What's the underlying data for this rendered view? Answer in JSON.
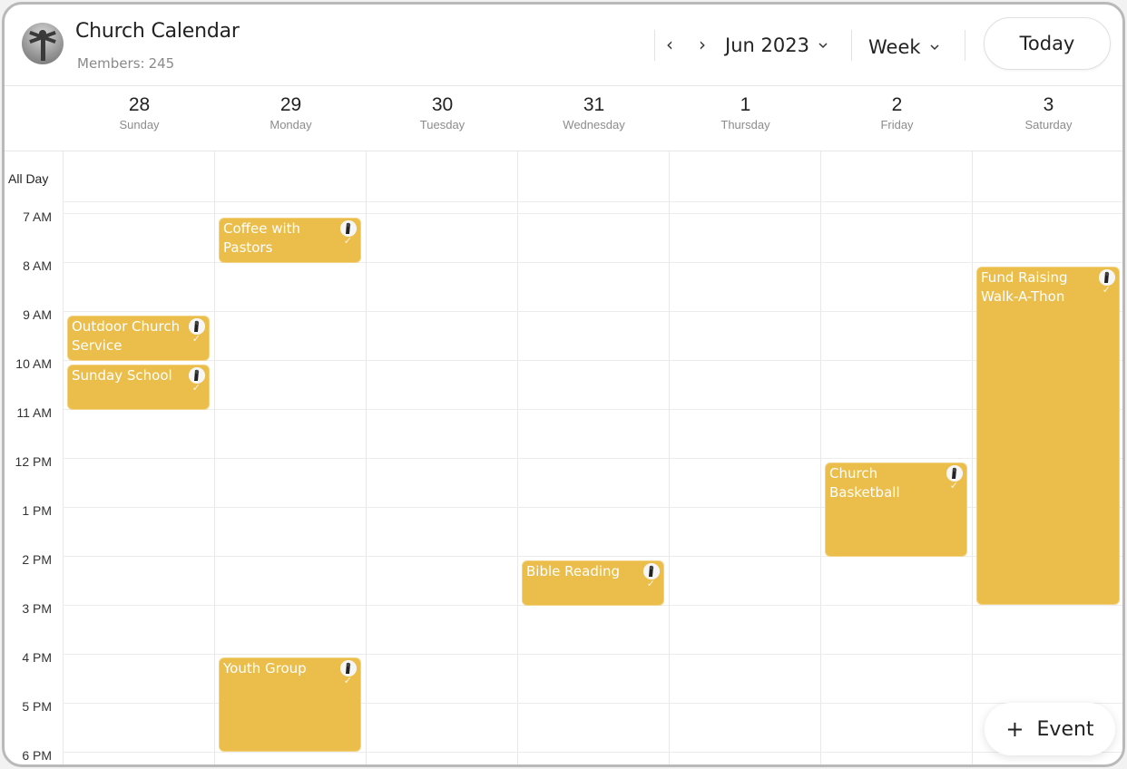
{
  "header": {
    "title": "Church Calendar",
    "members_label": "Members:",
    "members_count": "245",
    "month_label": "Jun 2023",
    "view_label": "Week",
    "today_label": "Today",
    "prev_icon": "chevron-left-icon",
    "next_icon": "chevron-right-icon"
  },
  "days": [
    {
      "num": "28",
      "name": "Sunday"
    },
    {
      "num": "29",
      "name": "Monday"
    },
    {
      "num": "30",
      "name": "Tuesday"
    },
    {
      "num": "31",
      "name": "Wednesday"
    },
    {
      "num": "1",
      "name": "Thursday"
    },
    {
      "num": "2",
      "name": "Friday"
    },
    {
      "num": "3",
      "name": "Saturday"
    }
  ],
  "all_day_label": "All Day",
  "hours": [
    "7 AM",
    "8 AM",
    "9 AM",
    "10 AM",
    "11 AM",
    "12 PM",
    "1 PM",
    "2 PM",
    "3 PM",
    "4 PM",
    "5 PM",
    "6 PM"
  ],
  "events": [
    {
      "title": "Coffee with Pastors",
      "day": "Monday",
      "start": "7 AM",
      "end": "8 AM"
    },
    {
      "title": "Outdoor Church Service",
      "day": "Sunday",
      "start": "9 AM",
      "end": "10 AM"
    },
    {
      "title": "Sunday School",
      "day": "Sunday",
      "start": "10 AM",
      "end": "11 AM"
    },
    {
      "title": "Fund Raising Walk-A-Thon",
      "day": "Saturday",
      "start": "8 AM",
      "end": "3 PM"
    },
    {
      "title": "Church Basketball",
      "day": "Friday",
      "start": "12 PM",
      "end": "2 PM"
    },
    {
      "title": "Bible Reading",
      "day": "Wednesday",
      "start": "2 PM",
      "end": "3 PM"
    },
    {
      "title": "Youth Group",
      "day": "Monday",
      "start": "4 PM",
      "end": "6 PM"
    }
  ],
  "add_event_label": "Event",
  "colors": {
    "event": "#ebbd4a",
    "border": "#b9b9b9"
  }
}
